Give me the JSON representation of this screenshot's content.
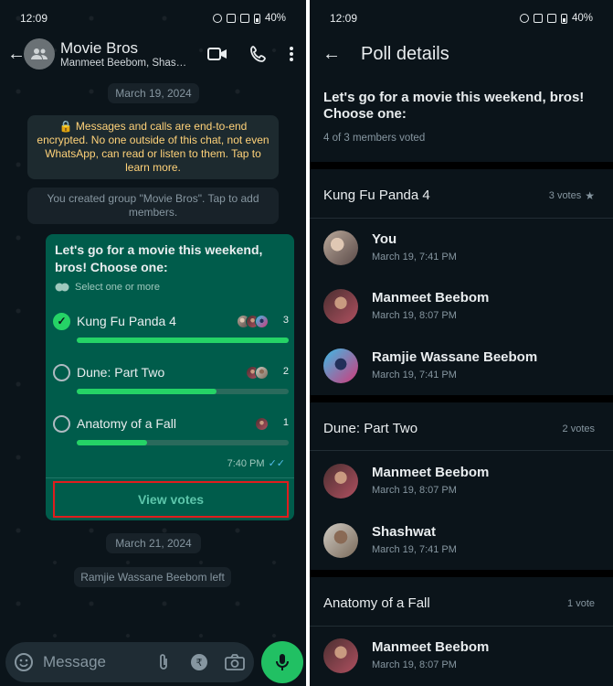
{
  "left": {
    "status": {
      "time": "12:09",
      "battery": "40%"
    },
    "header": {
      "title": "Movie Bros",
      "subtitle": "Manmeet Beebom, Shashwat"
    },
    "date_chip_1": "March 19, 2024",
    "encryption_notice": "Messages and calls are end-to-end encrypted. No one outside of this chat, not even WhatsApp, can read or listen to them. Tap to learn more.",
    "created_notice": "You created group \"Movie Bros\". Tap to add members.",
    "poll": {
      "question": "Let's go for a movie this weekend, bros! Choose one:",
      "hint": "Select one or more",
      "options": [
        {
          "label": "Kung Fu Panda 4",
          "count": "3",
          "fraction": 1.0,
          "checked": true
        },
        {
          "label": "Dune: Part Two",
          "count": "2",
          "fraction": 0.66,
          "checked": false
        },
        {
          "label": "Anatomy of a Fall",
          "count": "1",
          "fraction": 0.33,
          "checked": false
        }
      ],
      "time": "7:40 PM",
      "view_votes": "View votes"
    },
    "date_chip_2": "March 21, 2024",
    "left_notice": "Ramjie Wassane Beebom left",
    "input_placeholder": "Message"
  },
  "right": {
    "status": {
      "time": "12:09",
      "battery": "40%"
    },
    "header": {
      "title": "Poll details"
    },
    "question": "Let's go for a movie this weekend, bros! Choose one:",
    "voted": "4 of 3 members voted",
    "sections": [
      {
        "title": "Kung Fu Panda 4",
        "votes": "3 votes",
        "voters": [
          {
            "name": "You",
            "time": "March 19, 7:41 PM"
          },
          {
            "name": "Manmeet Beebom",
            "time": "March 19, 8:07 PM"
          },
          {
            "name": "Ramjie Wassane Beebom",
            "time": "March 19, 7:41 PM"
          }
        ]
      },
      {
        "title": "Dune: Part Two",
        "votes": "2 votes",
        "voters": [
          {
            "name": "Manmeet Beebom",
            "time": "March 19, 8:07 PM"
          },
          {
            "name": "Shashwat",
            "time": "March 19, 7:41 PM"
          }
        ]
      },
      {
        "title": "Anatomy of a Fall",
        "votes": "1 vote",
        "voters": [
          {
            "name": "Manmeet Beebom",
            "time": "March 19, 8:07 PM"
          }
        ]
      }
    ]
  },
  "colors": {
    "accent": "#25d366",
    "bubble": "#005c4b",
    "background": "#0b141a",
    "highlight": "#e01d1d"
  }
}
